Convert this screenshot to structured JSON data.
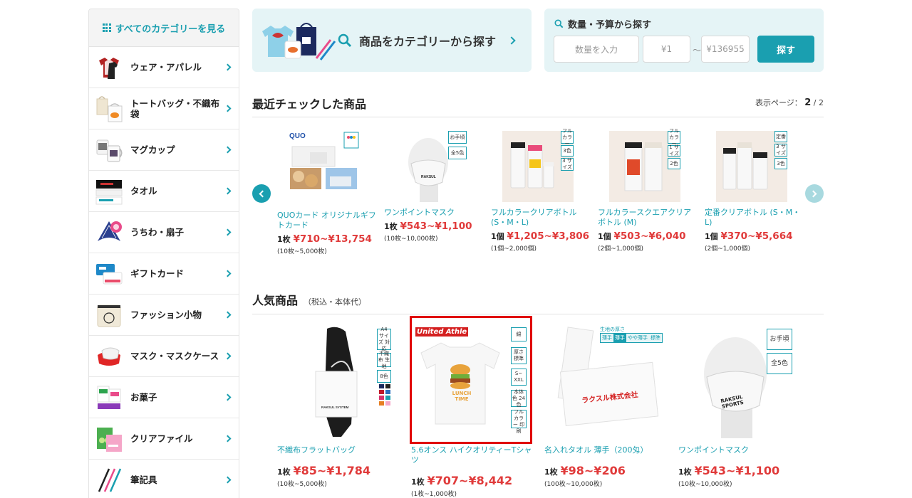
{
  "sidebar": {
    "header": "すべてのカテゴリーを見る",
    "items": [
      {
        "label": "ウェア・アパレル",
        "icon": "tshirt-icon"
      },
      {
        "label": "トートバッグ・不織布袋",
        "icon": "tote-bag-icon"
      },
      {
        "label": "マグカップ",
        "icon": "mug-icon"
      },
      {
        "label": "タオル",
        "icon": "towel-icon"
      },
      {
        "label": "うちわ・扇子",
        "icon": "fan-icon"
      },
      {
        "label": "ギフトカード",
        "icon": "gift-card-icon"
      },
      {
        "label": "ファッション小物",
        "icon": "pouch-icon"
      },
      {
        "label": "マスク・マスクケース",
        "icon": "mask-icon"
      },
      {
        "label": "お菓子",
        "icon": "snack-icon"
      },
      {
        "label": "クリアファイル",
        "icon": "clear-file-icon"
      },
      {
        "label": "筆記具",
        "icon": "pen-icon"
      }
    ]
  },
  "category_banner": {
    "label": "商品をカテゴリーから探す"
  },
  "qty_search": {
    "title": "数量・予算から探す",
    "qty_placeholder": "数量を入力",
    "min_price": "¥1",
    "tilde": "〜",
    "max_price": "¥136955",
    "button": "探す"
  },
  "recent": {
    "title": "最近チェックした商品",
    "page_label": "表示ページ：",
    "page_current": "2",
    "page_total": "/ 2",
    "items": [
      {
        "name": "QUOカード オリジナルギフトカード",
        "unit": "1枚",
        "price": "¥710~¥13,754",
        "min": "(10枚~5,000枚)",
        "tags": []
      },
      {
        "name": "ワンポイントマスク",
        "unit": "1枚",
        "price": "¥543~¥1,100",
        "min": "(10枚~10,000枚)",
        "tags": [
          "お手頃",
          "全5色"
        ]
      },
      {
        "name": "フルカラークリアボトル (S・M・L)",
        "unit": "1個",
        "price": "¥1,205~¥3,806",
        "min": "(1個~2,000個)",
        "tags": [
          "フル カラー",
          "3色",
          "3 サイズ"
        ]
      },
      {
        "name": "フルカラースクエアクリアボトル (M)",
        "unit": "1個",
        "price": "¥503~¥6,040",
        "min": "(2個~1,000個)",
        "tags": [
          "フル カラー",
          "1 サイズ",
          "2色"
        ]
      },
      {
        "name": "定番クリアボトル (S・M・L)",
        "unit": "1個",
        "price": "¥370~¥5,664",
        "min": "(2個~1,000個)",
        "tags": [
          "定番",
          "3 サイズ",
          "3色"
        ]
      }
    ]
  },
  "popular": {
    "title": "人気商品",
    "subtitle": "（税込・本体代）",
    "items": [
      {
        "name": "不織布フラットバッグ",
        "unit": "1枚",
        "price": "¥85~¥1,784",
        "min": "(10枚~5,000枚)",
        "tags": [
          "A4 サイズ 対応",
          "不織布 生地",
          "8色"
        ]
      },
      {
        "name": "5.6オンス ハイクオリティーTシャツ",
        "unit": "1枚",
        "price": "¥707~¥8,442",
        "min": "(1枚~1,000枚)",
        "brand": "United Athle",
        "print": "LUNCH TIME",
        "tags": [
          "綿",
          "厚さ 標準",
          "S~ XXL",
          "本体色 24色",
          "フルカラー 印刷"
        ]
      },
      {
        "name": "名入れタオル 薄手（200匁）",
        "unit": "1枚",
        "price": "¥98~¥206",
        "min": "(100枚~10,000枚)",
        "thickness_label": "生地の厚さ",
        "thickness": [
          "薄手",
          "やや薄手",
          "標準"
        ],
        "towel_print": "ラクスル株式会社"
      },
      {
        "name": "ワンポイントマスク",
        "unit": "1枚",
        "price": "¥543~¥1,100",
        "min": "(10枚~10,000枚)",
        "tags": [
          "お手頃",
          "全5色"
        ],
        "mask_print": "RAKSUL SPORTS"
      }
    ]
  },
  "colors": {
    "accent": "#1a9fb0",
    "price": "#e03a3a",
    "panel": "#e5f4f6",
    "highlight": "#e00000"
  }
}
